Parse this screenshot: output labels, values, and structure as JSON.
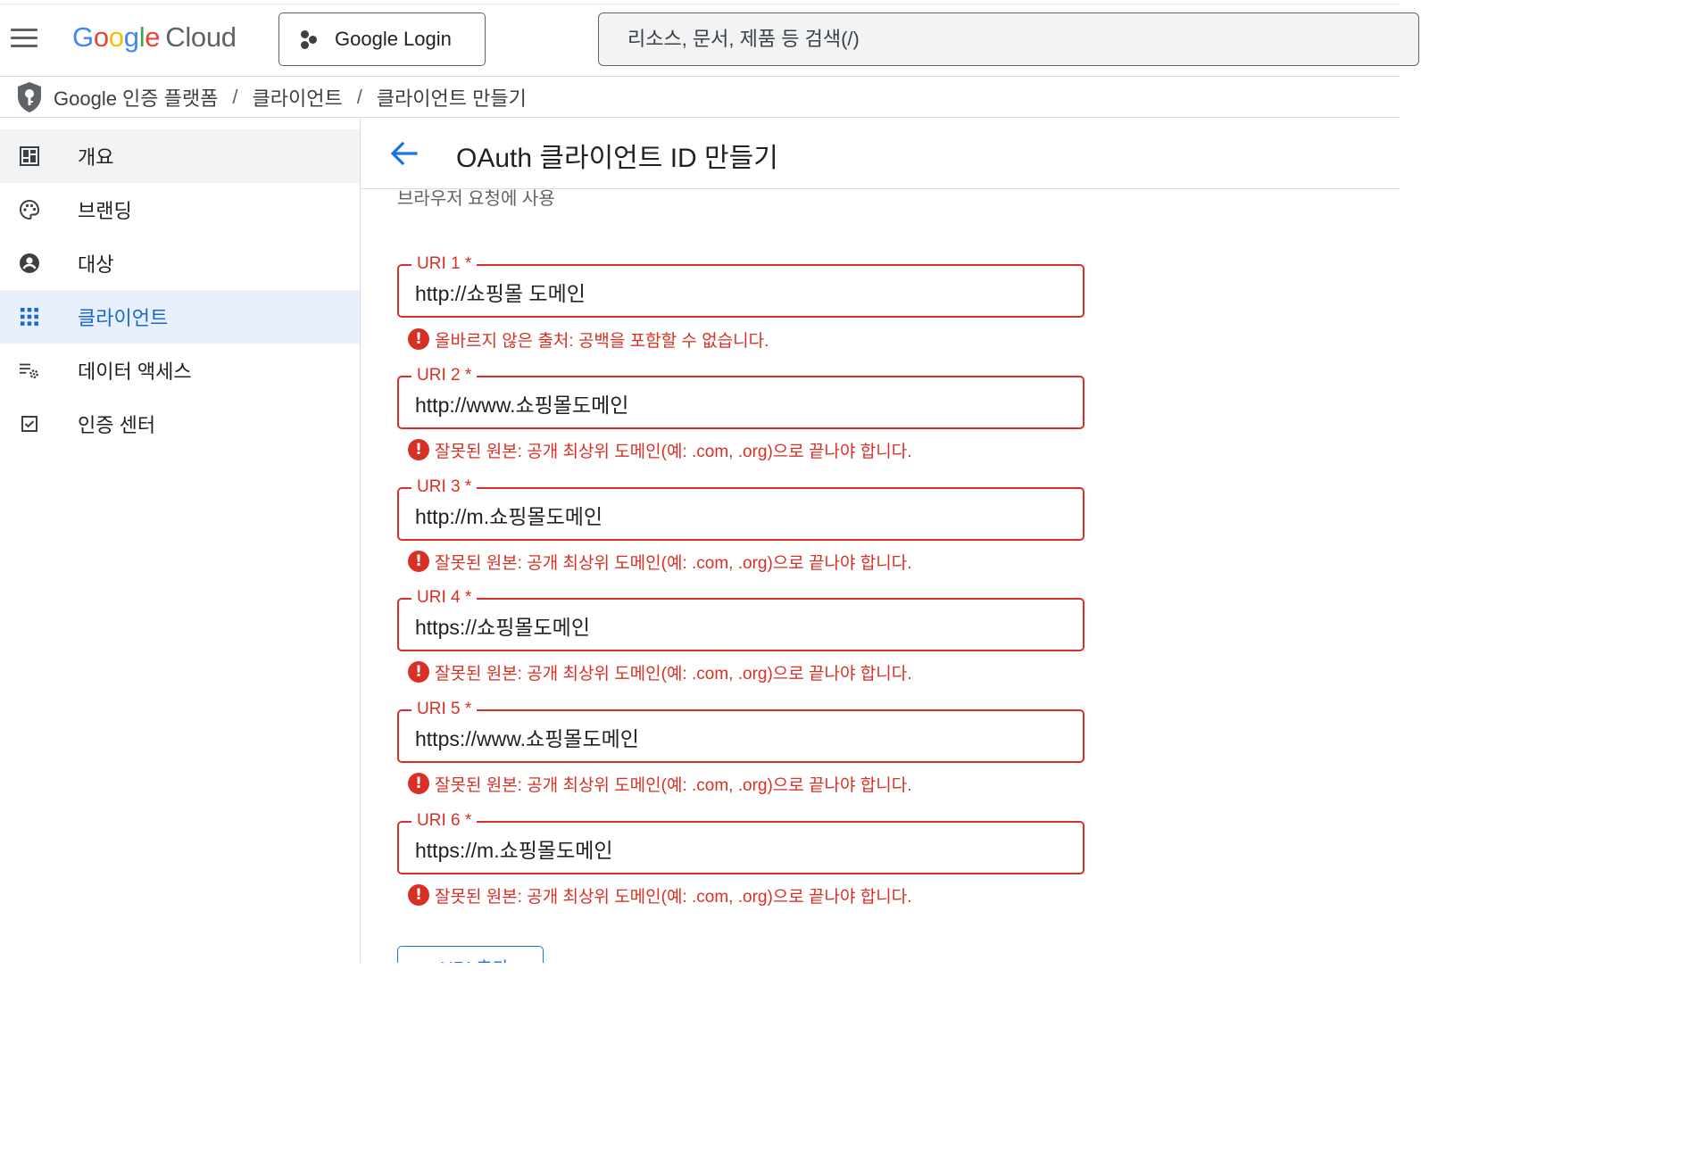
{
  "topbar": {
    "logo_google": [
      "G",
      "o",
      "o",
      "g",
      "l",
      "e"
    ],
    "logo_cloud": "Cloud",
    "project_label": "Google Login",
    "search_placeholder": "리소스, 문서, 제품 등 검색(/)"
  },
  "breadcrumb": {
    "items": [
      "Google 인증 플랫폼",
      "클라이언트",
      "클라이언트 만들기"
    ],
    "separator": "/"
  },
  "sidebar": {
    "items": [
      {
        "label": "개요",
        "icon": "dashboard-icon",
        "state": "hover"
      },
      {
        "label": "브랜딩",
        "icon": "palette-icon",
        "state": ""
      },
      {
        "label": "대상",
        "icon": "account-circle-icon",
        "state": ""
      },
      {
        "label": "클라이언트",
        "icon": "apps-grid-icon",
        "state": "active"
      },
      {
        "label": "데이터 액세스",
        "icon": "list-settings-icon",
        "state": ""
      },
      {
        "label": "인증 센터",
        "icon": "checkbox-icon",
        "state": ""
      }
    ]
  },
  "main": {
    "title": "OAuth 클라이언트 ID 만들기",
    "section_hint": "브라우저 요청에 사용",
    "fields": [
      {
        "label": "URI 1 *",
        "value": "http://쇼핑몰 도메인",
        "error": "올바르지 않은 출처: 공백을 포함할 수 없습니다."
      },
      {
        "label": "URI 2 *",
        "value": "http://www.쇼핑몰도메인",
        "error": "잘못된 원본: 공개 최상위 도메인(예: .com, .org)으로 끝나야 합니다."
      },
      {
        "label": "URI 3 *",
        "value": "http://m.쇼핑몰도메인",
        "error": "잘못된 원본: 공개 최상위 도메인(예: .com, .org)으로 끝나야 합니다."
      },
      {
        "label": "URI 4 *",
        "value": "https://쇼핑몰도메인",
        "error": "잘못된 원본: 공개 최상위 도메인(예: .com, .org)으로 끝나야 합니다."
      },
      {
        "label": "URI 5 *",
        "value": "https://www.쇼핑몰도메인",
        "error": "잘못된 원본: 공개 최상위 도메인(예: .com, .org)으로 끝나야 합니다."
      },
      {
        "label": "URI 6 *",
        "value": "https://m.쇼핑몰도메인",
        "error": "잘못된 원본: 공개 최상위 도메인(예: .com, .org)으로 끝나야 합니다."
      }
    ],
    "add_button_label": "+ URI 추가"
  },
  "colors": {
    "error": "#d93025",
    "accent": "#1a73e8",
    "active_nav_bg": "#e8f0fe"
  }
}
